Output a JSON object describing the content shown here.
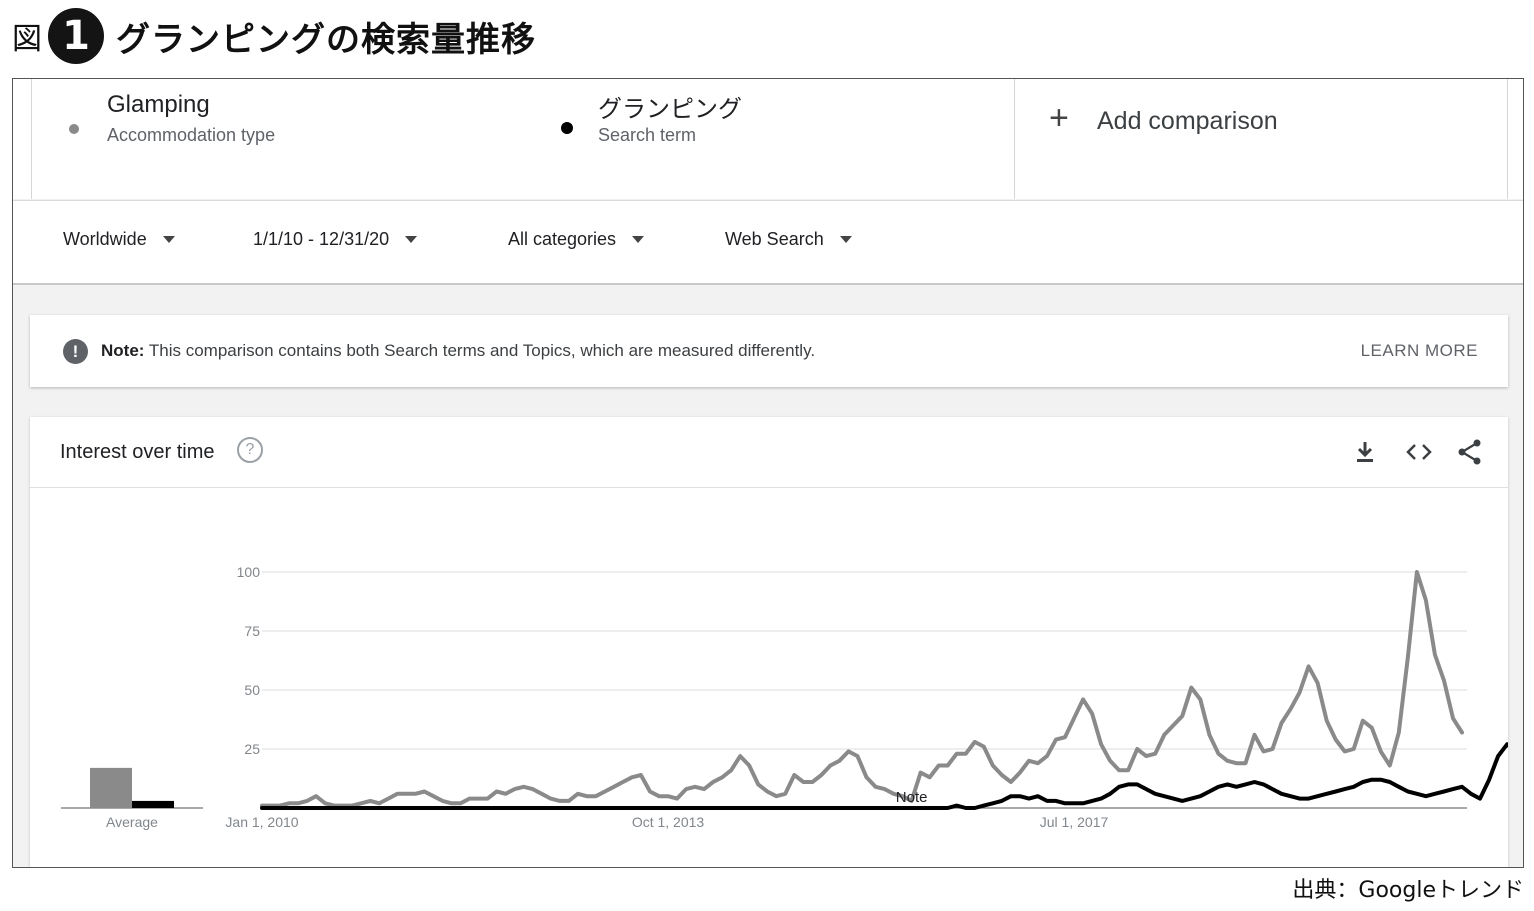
{
  "figure": {
    "label": "図",
    "number": "1",
    "title": "グランピングの検索量推移",
    "source": "出典：Googleトレンド"
  },
  "terms": [
    {
      "name": "Glamping",
      "type": "Accommodation type",
      "color": "#8a8a8a"
    },
    {
      "name": "グランピング",
      "type": "Search term",
      "color": "#000000"
    }
  ],
  "add_comparison": {
    "icon": "plus-icon",
    "label": "Add comparison"
  },
  "filters": {
    "region": "Worldwide",
    "date_range": "1/1/10 - 12/31/20",
    "category": "All categories",
    "search_type": "Web Search"
  },
  "note": {
    "icon": "exclamation-icon",
    "label": "Note:",
    "text": "This comparison contains both Search terms and Topics, which are measured differently.",
    "action": "LEARN MORE"
  },
  "chart_header": {
    "title": "Interest over time",
    "icons": [
      "help-icon",
      "download-icon",
      "embed-icon",
      "share-icon"
    ]
  },
  "chart_data": {
    "type": "line",
    "title": "",
    "xlabel": "",
    "ylabel": "",
    "ylim": [
      0,
      100
    ],
    "y_ticks": [
      "100",
      "75",
      "50",
      "25"
    ],
    "x_tick_labels": [
      "Jan 1, 2010",
      "Oct 1, 2013",
      "Jul 1, 2017"
    ],
    "x_tick_index": [
      0,
      45,
      90
    ],
    "x_start": "2010-01",
    "x_end": "2020-12",
    "grid": true,
    "annotation": {
      "text": "Note",
      "month": "2016-01"
    },
    "average_label": "Average",
    "averages": [
      17,
      3
    ],
    "series": [
      {
        "color": "#8a8a8a",
        "values": [
          1,
          1,
          1,
          2,
          2,
          3,
          5,
          2,
          1,
          1,
          1,
          2,
          3,
          2,
          4,
          6,
          6,
          6,
          7,
          5,
          3,
          2,
          2,
          4,
          4,
          4,
          7,
          6,
          8,
          9,
          8,
          6,
          4,
          3,
          3,
          6,
          5,
          5,
          7,
          9,
          11,
          13,
          14,
          7,
          5,
          5,
          4,
          8,
          9,
          8,
          11,
          13,
          16,
          22,
          18,
          10,
          7,
          5,
          6,
          14,
          11,
          11,
          14,
          18,
          20,
          24,
          22,
          13,
          9,
          8,
          6,
          5,
          3,
          15,
          13,
          18,
          18,
          23,
          23,
          28,
          26,
          18,
          14,
          11,
          15,
          20,
          19,
          22,
          29,
          30,
          38,
          46,
          40,
          27,
          20,
          16,
          16,
          25,
          22,
          23,
          31,
          35,
          39,
          51,
          46,
          31,
          23,
          20,
          19,
          19,
          31,
          24,
          25,
          36,
          42,
          49,
          60,
          53,
          37,
          29,
          24,
          25,
          37,
          34,
          24,
          18,
          32,
          64,
          100,
          88,
          65,
          54,
          38,
          32
        ],
        "legend": "Glamping"
      },
      {
        "color": "#000000",
        "values": [
          0,
          0,
          0,
          0,
          0,
          0,
          0,
          0,
          0,
          0,
          0,
          0,
          0,
          0,
          0,
          0,
          0,
          0,
          0,
          0,
          0,
          0,
          0,
          0,
          0,
          0,
          0,
          0,
          0,
          0,
          0,
          0,
          0,
          0,
          0,
          0,
          0,
          0,
          0,
          0,
          0,
          0,
          0,
          0,
          0,
          0,
          0,
          0,
          0,
          0,
          0,
          0,
          0,
          0,
          0,
          0,
          0,
          0,
          0,
          0,
          0,
          0,
          0,
          0,
          0,
          0,
          0,
          0,
          0,
          0,
          0,
          0,
          0,
          0,
          0,
          0,
          0,
          1,
          0,
          0,
          1,
          2,
          3,
          5,
          5,
          4,
          5,
          3,
          3,
          2,
          2,
          2,
          3,
          4,
          6,
          9,
          10,
          10,
          8,
          6,
          5,
          4,
          3,
          4,
          5,
          7,
          9,
          10,
          9,
          10,
          11,
          10,
          8,
          6,
          5,
          4,
          4,
          5,
          6,
          7,
          8,
          9,
          11,
          12,
          12,
          11,
          9,
          7,
          6,
          5,
          6,
          7,
          8,
          9,
          6,
          4,
          12,
          22,
          27,
          24,
          16,
          13,
          9
        ],
        "legend": "グランピング"
      }
    ]
  }
}
